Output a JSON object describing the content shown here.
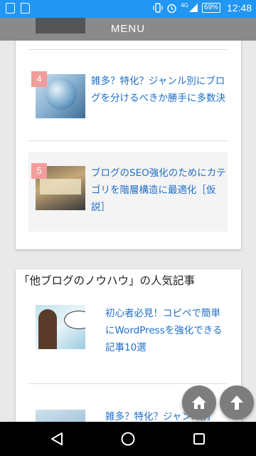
{
  "status_bar": {
    "left_icons": [
      "image-notification-icon",
      "sd-card-icon"
    ],
    "right_icons": [
      "vibrate-icon",
      "alarm-icon",
      "signal-4g-icon"
    ],
    "network": "4G",
    "battery": "69%",
    "time": "12:48"
  },
  "header": {
    "menu_label": "MENU"
  },
  "ranking": {
    "items": [
      {
        "rank": "4",
        "title": "雑多？特化？ジャンル別にブログを分けるべきか勝手に多数決"
      },
      {
        "rank": "5",
        "title": "ブログのSEO強化のためにカテゴリを階層構造に最適化［仮説］"
      }
    ]
  },
  "popular": {
    "section_title": "「他ブログのノウハウ」の人気記事",
    "items": [
      {
        "title": "初心者必見！コピペで簡単にWordPressを強化できる記事10選"
      },
      {
        "title": "雑多？特化？ジャンル別"
      }
    ]
  },
  "fab": {
    "home_icon": "home-icon",
    "top_icon": "arrow-up-icon"
  },
  "nav": {
    "back_icon": "back-triangle-icon",
    "home_icon": "home-circle-icon",
    "recents_icon": "recents-square-icon"
  }
}
